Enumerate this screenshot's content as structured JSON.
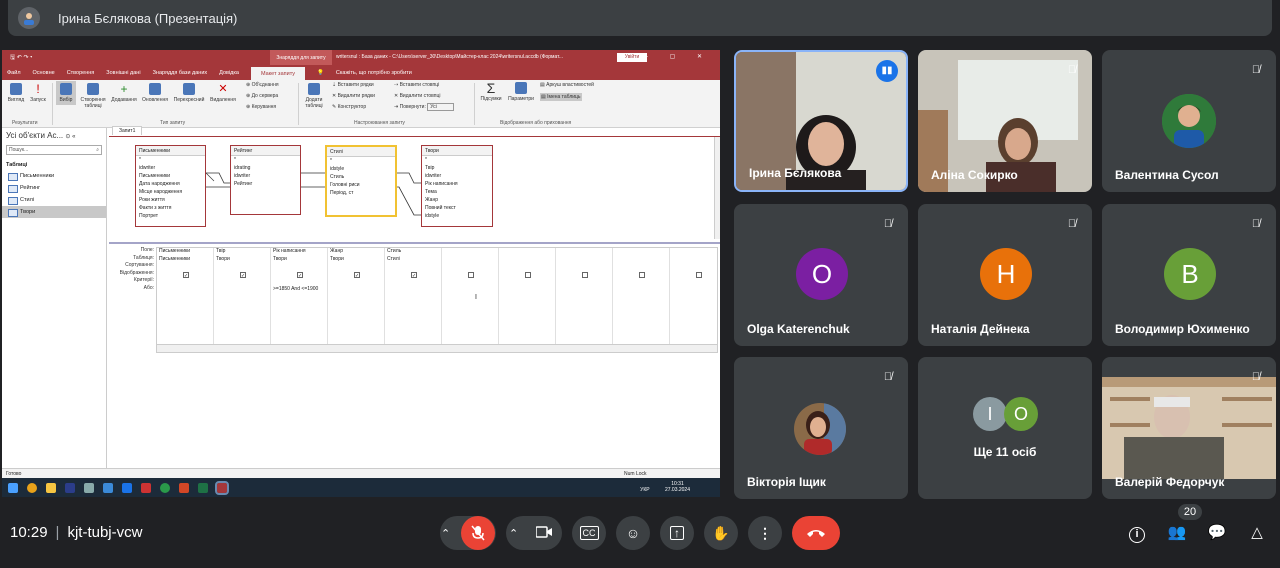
{
  "meeting": {
    "presenter_title": "Ірина Бєлякова (Презентація)",
    "clock": "10:29",
    "meeting_code": "kjt-tubj-vcw",
    "participants_count": "20"
  },
  "access": {
    "context_label": "Знаряддя для запиту",
    "window_title": "writersnul : База даних - C:\\Users\\server_30\\Desktop\\Майстер-клас 2024\\writersnul.accdb (Формат...",
    "sign_in": "Увійти",
    "window_controls": "? — ▢ ✕",
    "tabs": [
      "Файл",
      "Основне",
      "Створення",
      "Зовнішні дані",
      "Знаряддя бази даних",
      "Довідка",
      "Макет запиту",
      "Скажіть, що потрібно зробити"
    ],
    "ribbon": {
      "view": "Вигляд",
      "run": "Запуск",
      "select": "Вибір",
      "make_table": "Створення таблиці",
      "append": "Додавання",
      "update": "Оновлення",
      "crosstab": "Перехресний",
      "delete": "Видалення",
      "union": "Об'єднання",
      "passthrough": "До сервера",
      "data_def": "Керування",
      "show_table": "Додати таблиці",
      "insert_rows": "Вставити рядки",
      "delete_rows": "Видалити рядки",
      "builder": "Конструктор",
      "insert_cols": "Вставити стовпці",
      "delete_cols": "Видалити стовпці",
      "return_label": "Повернути:",
      "return_value": "Усі",
      "totals": "Підсумки",
      "params": "Параметри",
      "prop_sheet": "Аркуш властивостей",
      "table_names": "Імена таблиць",
      "grp_results": "Результати",
      "grp_type": "Тип запиту",
      "grp_setup": "Настроювання запиту",
      "grp_show": "Відображення або приховання"
    },
    "nav": {
      "header": "Усі об'єкти Ac...",
      "search_placeholder": "Пошук...",
      "section": "Таблиці",
      "items": [
        "Письменники",
        "Рейтинг",
        "Стилі",
        "Твори"
      ]
    },
    "query_tab": "Запит1",
    "tables": [
      {
        "name": "Письменники",
        "fields": [
          "*",
          "idwriter",
          "Письменники",
          "Дата народження",
          "Місце народження",
          "Роки життя",
          "Факти з життя",
          "Портрет"
        ]
      },
      {
        "name": "Рейтинг",
        "fields": [
          "*",
          "idrating",
          "idwriter",
          "Рейтинг"
        ]
      },
      {
        "name": "Стилі",
        "fields": [
          "*",
          "idstyle",
          "Стиль",
          "Головні риси",
          "Період, ст"
        ]
      },
      {
        "name": "Твори",
        "fields": [
          "*",
          "Твір",
          "idwriter",
          "Рік написання",
          "Тема",
          "Жанр",
          "Повний текст",
          "idstyle"
        ]
      }
    ],
    "grid_labels": [
      "Поле:",
      "Таблиця:",
      "Сортування:",
      "Відображення:",
      "Критерії:",
      "Або:"
    ],
    "grid_columns": [
      {
        "field": "Письменники",
        "table": "Письменники",
        "show": true,
        "criteria": ""
      },
      {
        "field": "Твір",
        "table": "Твори",
        "show": true,
        "criteria": ""
      },
      {
        "field": "Рік написання",
        "table": "Твори",
        "show": true,
        "criteria": ">=1850 And <=1900"
      },
      {
        "field": "Жанр",
        "table": "Твори",
        "show": true,
        "criteria": ""
      },
      {
        "field": "Стиль",
        "table": "Стилі",
        "show": true,
        "criteria": ""
      }
    ],
    "status_left": "Готово",
    "status_right": "Num Lock",
    "tray_lang": "УКР",
    "tray_time": "10:31",
    "tray_date": "27.03.2024"
  },
  "participants": [
    {
      "name": "Ірина Бєлякова",
      "kind": "video",
      "speaking": true
    },
    {
      "name": "Аліна Сокирко",
      "kind": "video",
      "muted": true
    },
    {
      "name": "Валентина Сусол",
      "kind": "photo",
      "muted": true
    },
    {
      "name": "Olga Katerenchuk",
      "kind": "letter",
      "letter": "O",
      "color": "#7b1fa2",
      "muted": true
    },
    {
      "name": "Наталія Дейнека",
      "kind": "letter",
      "letter": "Н",
      "color": "#e8710a",
      "muted": true
    },
    {
      "name": "Володимир Юхименко",
      "kind": "letter",
      "letter": "В",
      "color": "#689f38",
      "muted": true
    },
    {
      "name": "Вікторія Іщик",
      "kind": "photo",
      "muted": true
    },
    {
      "name": "Ще 11 осіб",
      "kind": "group",
      "letters": [
        "І",
        "O"
      ]
    },
    {
      "name": "Валерій Федорчук",
      "kind": "video",
      "muted": true
    }
  ],
  "colors": {
    "accent_red": "#a4373a",
    "end_call": "#ea4335",
    "speaking_blue": "#8ab4f8"
  }
}
